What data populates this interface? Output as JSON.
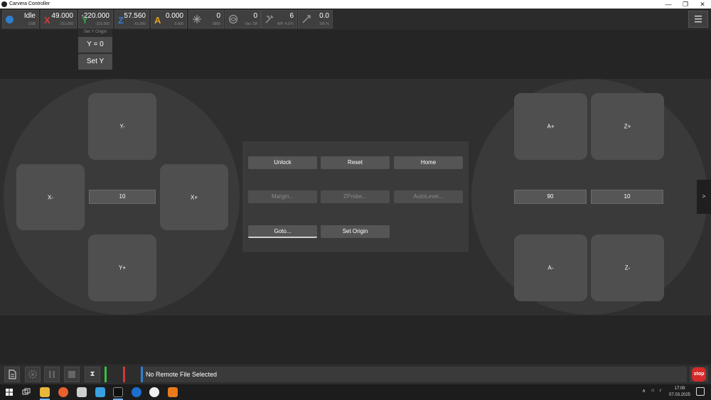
{
  "window": {
    "title": "Carvera Controller",
    "minimize": "—",
    "maximize": "❐",
    "close": "✕"
  },
  "status": {
    "state": "Idle",
    "connection": "USB",
    "color": "#2f7fd0"
  },
  "axes": {
    "x": {
      "letter": "X",
      "value": "49.000",
      "sub": "-211.000",
      "color": "#d03a3a"
    },
    "y": {
      "letter": "Y",
      "value": "-220.000",
      "sub": "-221.000",
      "color": "#3aa04a"
    },
    "z": {
      "letter": "Z",
      "value": "57.560",
      "sub": "-61.000",
      "color": "#2f7fd0"
    },
    "a": {
      "letter": "A",
      "value": "0.000",
      "sub": "0.000",
      "color": "#e0a020"
    }
  },
  "spindle": {
    "value": "0",
    "sub": "3000",
    "icon": "spindle-icon"
  },
  "vacuum": {
    "value": "0",
    "sub": "Vac: Off",
    "icon": "vacuum-icon"
  },
  "tool": {
    "value": "6",
    "sub": "WP: 4.07v",
    "icon": "tool-icon"
  },
  "feed": {
    "value": "0.0",
    "sub": "100 %",
    "icon": "feed-icon"
  },
  "menu": {
    "icon": "menu-icon"
  },
  "set_origin_dropdown": {
    "title": "Set Y Origin",
    "zero_label": "Y = 0",
    "set_label": "Set Y"
  },
  "jog": {
    "y_minus": "Y-",
    "y_plus": "Y+",
    "x_minus": "X-",
    "x_plus": "X+",
    "xy_step": "10",
    "a_plus": "A+",
    "a_minus": "A-",
    "z_plus": "Z+",
    "z_minus": "Z-",
    "a_step": "90",
    "z_step": "10"
  },
  "actions": {
    "unlock": "Unlock",
    "reset": "Reset",
    "home": "Home",
    "margin": "Margin...",
    "zprobe": "ZProbe...",
    "autolevel": "AutoLevel...",
    "goto": "Goto...",
    "set_origin": "Set Origin"
  },
  "side_toggle": ">",
  "bottom": {
    "file_status": "No Remote File Selected",
    "stop_label": "stop",
    "hourglass": "⧗"
  },
  "taskbar": {
    "time": "17:09",
    "date": "07.03.2025"
  }
}
